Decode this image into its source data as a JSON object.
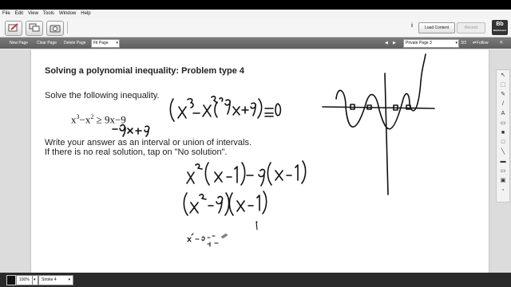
{
  "menu": [
    "File",
    "Edit",
    "View",
    "Tools",
    "Window",
    "Help"
  ],
  "toolbar": {
    "load_content": "Load Content",
    "record": "Record",
    "info": "i",
    "logo_main": "Bb",
    "logo_sub": "Blackboard"
  },
  "pagebar": {
    "new_page": "New Page",
    "clear_page": "Clear Page",
    "delete_page": "Delete Page",
    "fit_page": "Fit Page",
    "page_name": "Private Page 3",
    "page_count": "3/3",
    "follow": "Follow"
  },
  "problem": {
    "title": "Solving a polynomial inequality: Problem type 4",
    "instruction": "Solve the following inequality.",
    "lhs": "x",
    "lhs_exp1": "3",
    "minus": "−x",
    "lhs_exp2": "2",
    "rhs": " ≥ 9x−9",
    "answer_line1": "Write your answer as an interval or union of intervals.",
    "answer_line2": "If there is no real solution, tap on \"No solution\"."
  },
  "status": {
    "zoom": "100%",
    "stroke": "Stroke 4"
  }
}
